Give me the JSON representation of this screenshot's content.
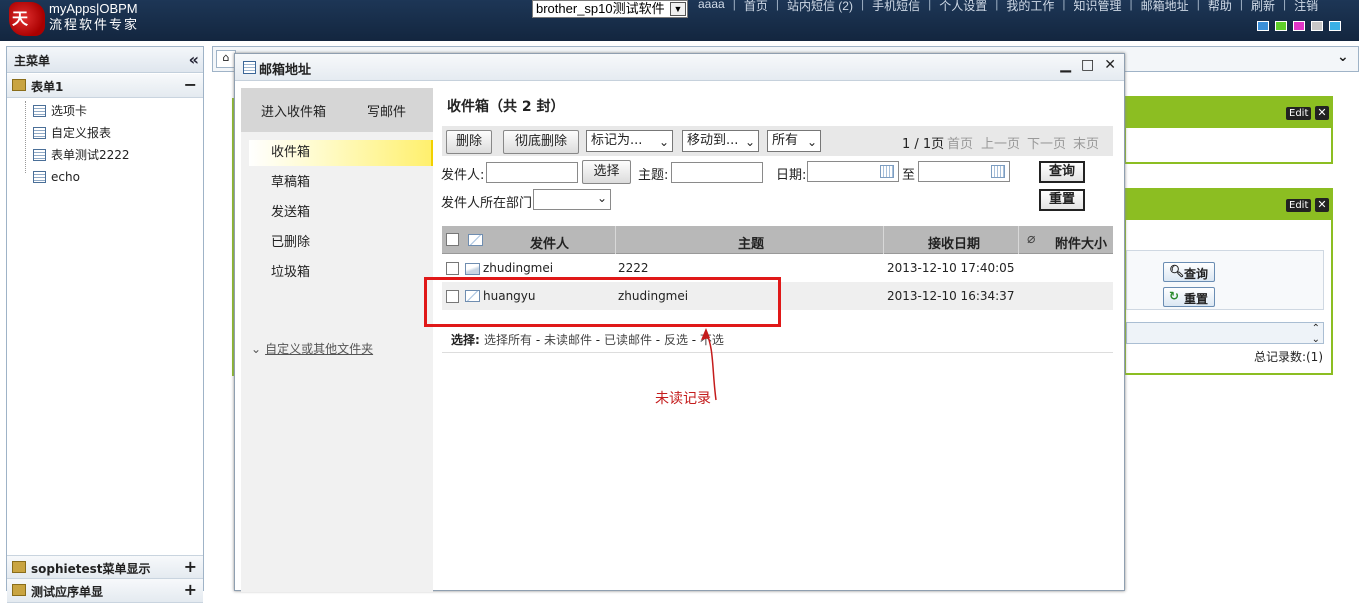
{
  "header": {
    "logo_char": "天",
    "brand_line1": "myApps|OBPM",
    "brand_line2": "流程软件专家",
    "app_select_value": "brother_sp10测试软件",
    "nav": [
      "aaaa",
      "首页",
      "站内短信 (2)",
      "手机短信",
      "个人设置",
      "我的工作",
      "知识管理",
      "邮箱地址",
      "帮助",
      "刷新",
      "注销"
    ],
    "theme_colors": [
      "#3a8fd8",
      "#5fcf2a",
      "#e236c8",
      "#c8c8c8",
      "#39b0e6"
    ]
  },
  "left_menu": {
    "title": "主菜单",
    "group1": {
      "label": "表单1",
      "toggle": "−",
      "items": [
        "选项卡",
        "自定义报表",
        "表单测试2222",
        "echo"
      ]
    },
    "group2": {
      "label": "sophietest菜单显示",
      "toggle": "+"
    },
    "group3": {
      "label": "测试应序单显",
      "toggle": "+"
    }
  },
  "background": {
    "card1": {
      "edit": "Edit",
      "close": "✕"
    },
    "card2": {
      "edit": "Edit",
      "close": "✕",
      "query_btn": "查询",
      "reset_btn": "重置",
      "total": "总记录数:(1)"
    }
  },
  "dialog": {
    "title": "邮箱地址",
    "controls": {
      "minimize": "▁",
      "maximize": "□",
      "close": "✕"
    },
    "nav": {
      "enter_inbox": "进入收件箱",
      "compose": "写邮件",
      "folders": [
        "收件箱",
        "草稿箱",
        "发送箱",
        "已删除",
        "垃圾箱"
      ],
      "custom_folders": "自定义或其他文件夹"
    },
    "inbox_title": "收件箱（共 2 封）",
    "toolbar": {
      "delete": "删除",
      "perm_delete": "彻底删除",
      "mark_as": "标记为...",
      "move_to": "移动到...",
      "filter": "所有",
      "page_info": "1 / 1页",
      "first": "首页",
      "prev": "上一页",
      "next": "下一页",
      "last": "末页"
    },
    "search": {
      "sender_label": "发件人:",
      "select_btn": "选择",
      "subject_label": "主题:",
      "date_label": "日期:",
      "to_label": "至",
      "dept_label": "发件人所在部门:",
      "query_btn": "查询",
      "reset_btn": "重置"
    },
    "table": {
      "columns": [
        "发件人",
        "主题",
        "接收日期",
        "附件大小"
      ],
      "rows": [
        {
          "sender": "zhudingmei",
          "subject": "2222",
          "date": "2013-12-10 17:40:05",
          "read": true
        },
        {
          "sender": "huangyu",
          "subject": "zhudingmei",
          "date": "2013-12-10 16:34:37",
          "read": false
        }
      ]
    },
    "select_bar": {
      "label": "选择:",
      "options": [
        "选择所有",
        "未读邮件",
        "已读邮件",
        "反选",
        "不选"
      ],
      "separator": " - "
    }
  },
  "annotation": {
    "text": "未读记录",
    "color": "#c41c1c"
  }
}
